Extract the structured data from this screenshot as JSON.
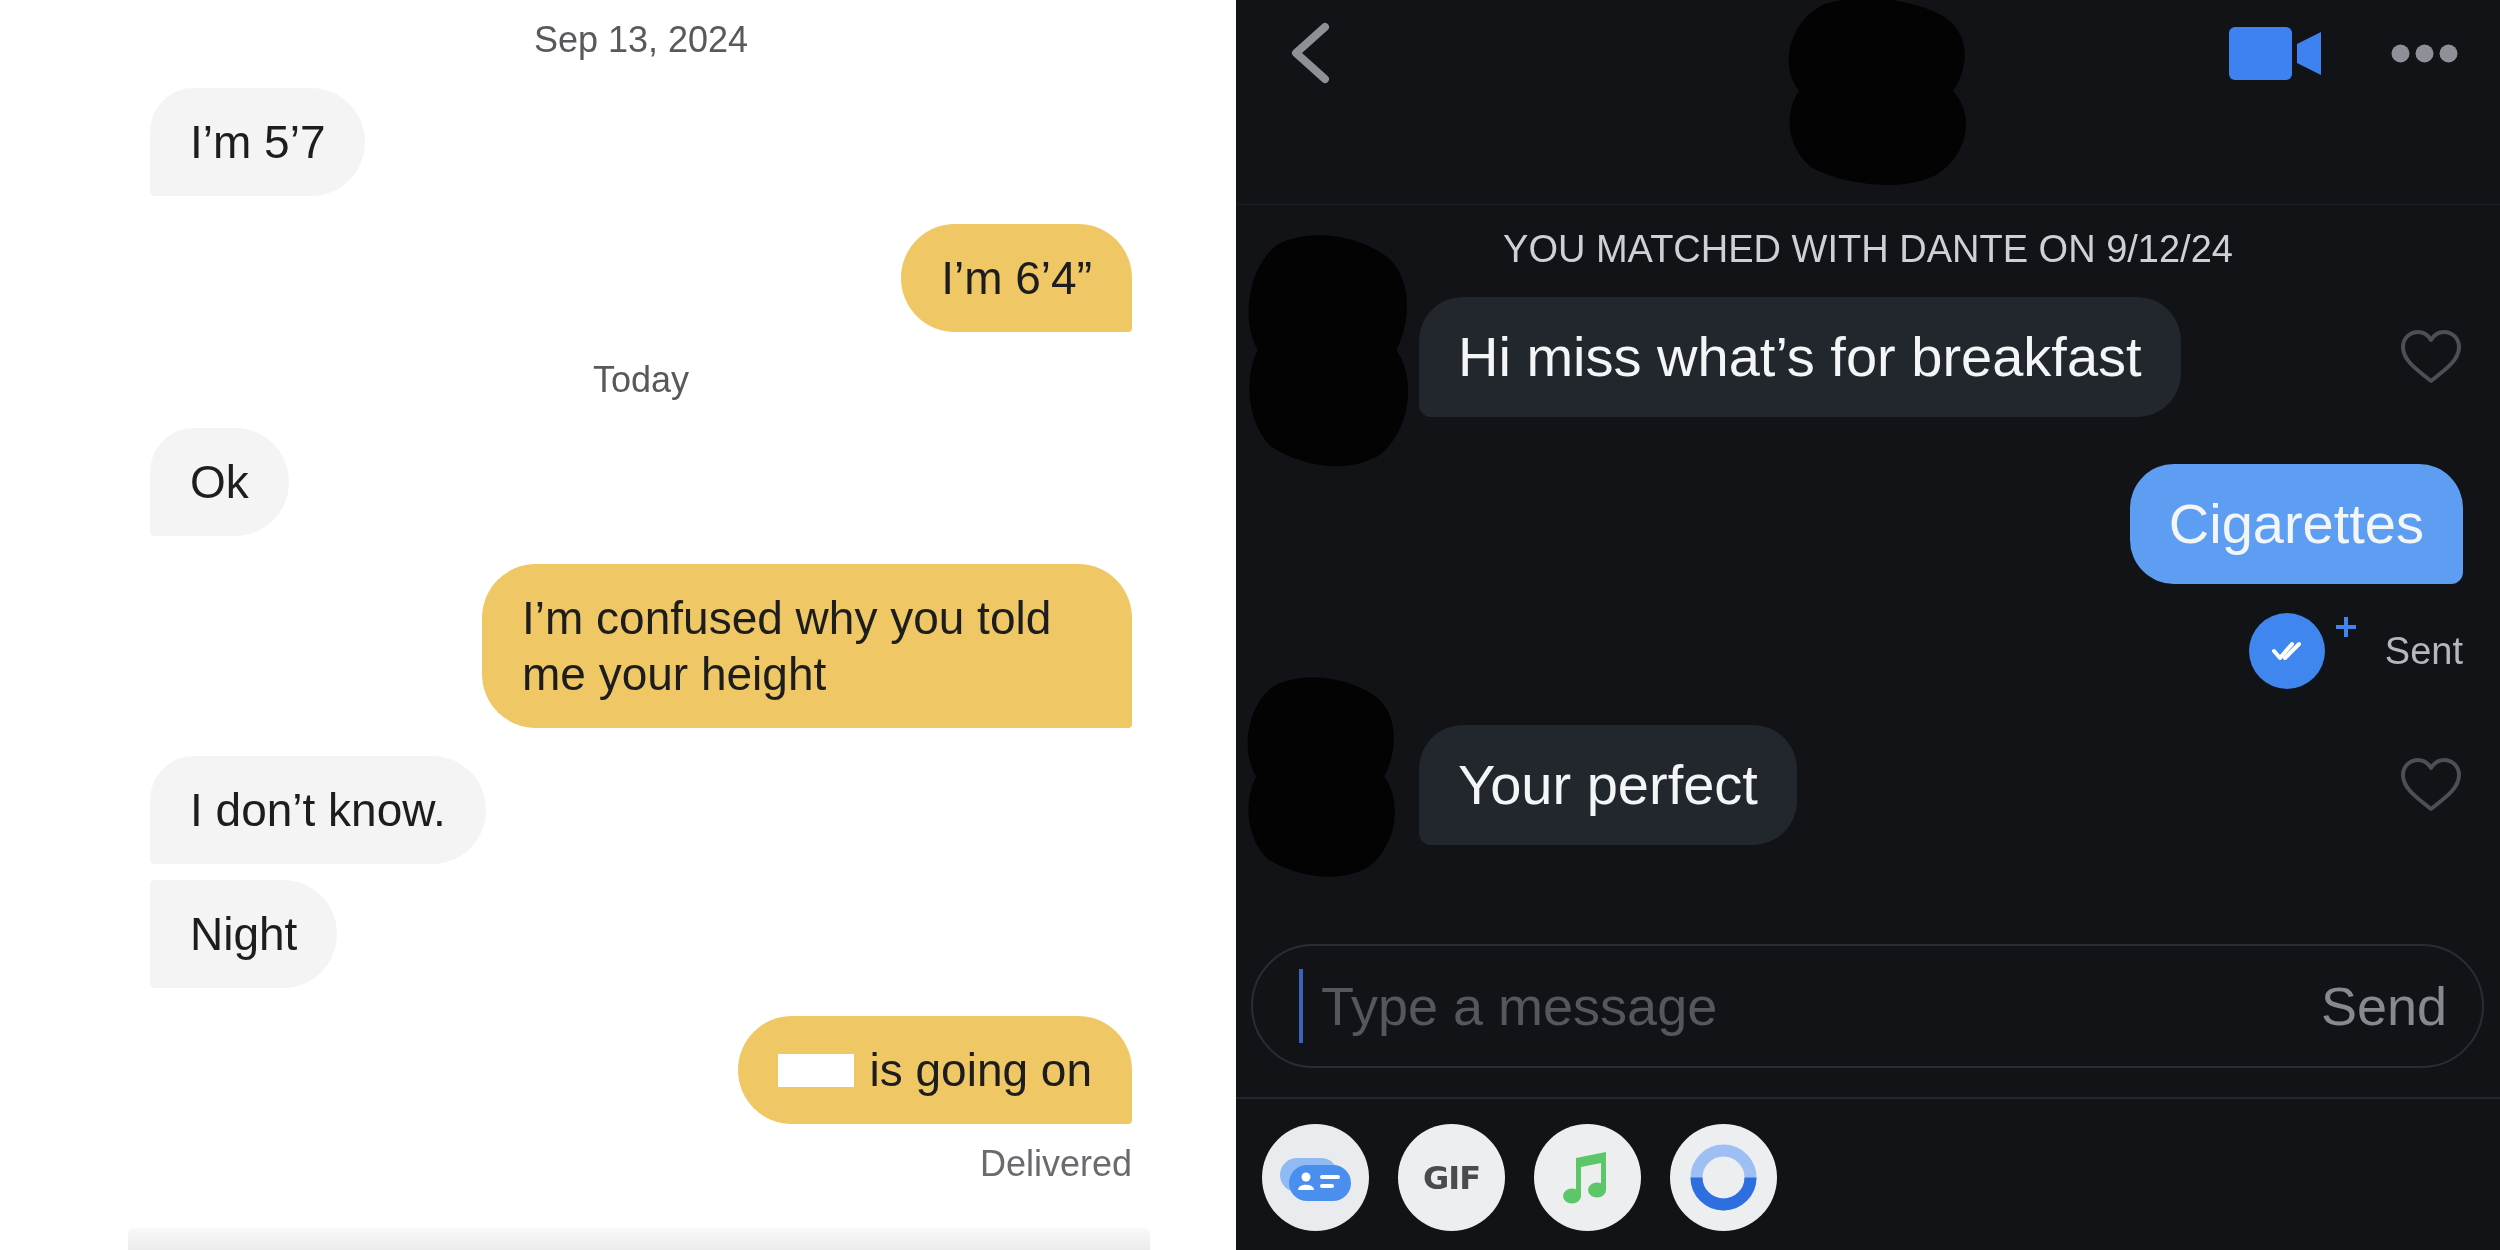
{
  "left_chat": {
    "messages": [
      {
        "kind": "date",
        "text": "Sep 13, 2024"
      },
      {
        "kind": "received",
        "text": "I’m 5’7",
        "redacted": false
      },
      {
        "kind": "sent",
        "text": "I’m 6’4”",
        "redacted": false
      },
      {
        "kind": "date",
        "text": "Today"
      },
      {
        "kind": "received",
        "text": "Ok",
        "redacted": false
      },
      {
        "kind": "sent",
        "text": "I’m confused why you told me your height",
        "redacted": false
      },
      {
        "kind": "received",
        "text": "I don’t know.",
        "redacted": false
      },
      {
        "kind": "received",
        "text": "Night",
        "redacted": false
      },
      {
        "kind": "sent",
        "text": "is going on",
        "redacted": true
      }
    ],
    "status": "Delivered"
  },
  "right_chat": {
    "match_notice": "YOU MATCHED WITH DANTE ON 9/12/24",
    "messages": [
      {
        "kind": "received",
        "text": "Hi miss what’s for breakfast",
        "liked": false
      },
      {
        "kind": "sent",
        "text": "Cigarettes",
        "status": "Sent"
      },
      {
        "kind": "received",
        "text": "Your perfect",
        "liked": false
      }
    ],
    "composer": {
      "placeholder": "Type a message",
      "send": "Send"
    },
    "attachments": [
      {
        "kind": "card"
      },
      {
        "kind": "gif",
        "label": "GIF"
      },
      {
        "kind": "music"
      },
      {
        "kind": "ring"
      }
    ]
  }
}
